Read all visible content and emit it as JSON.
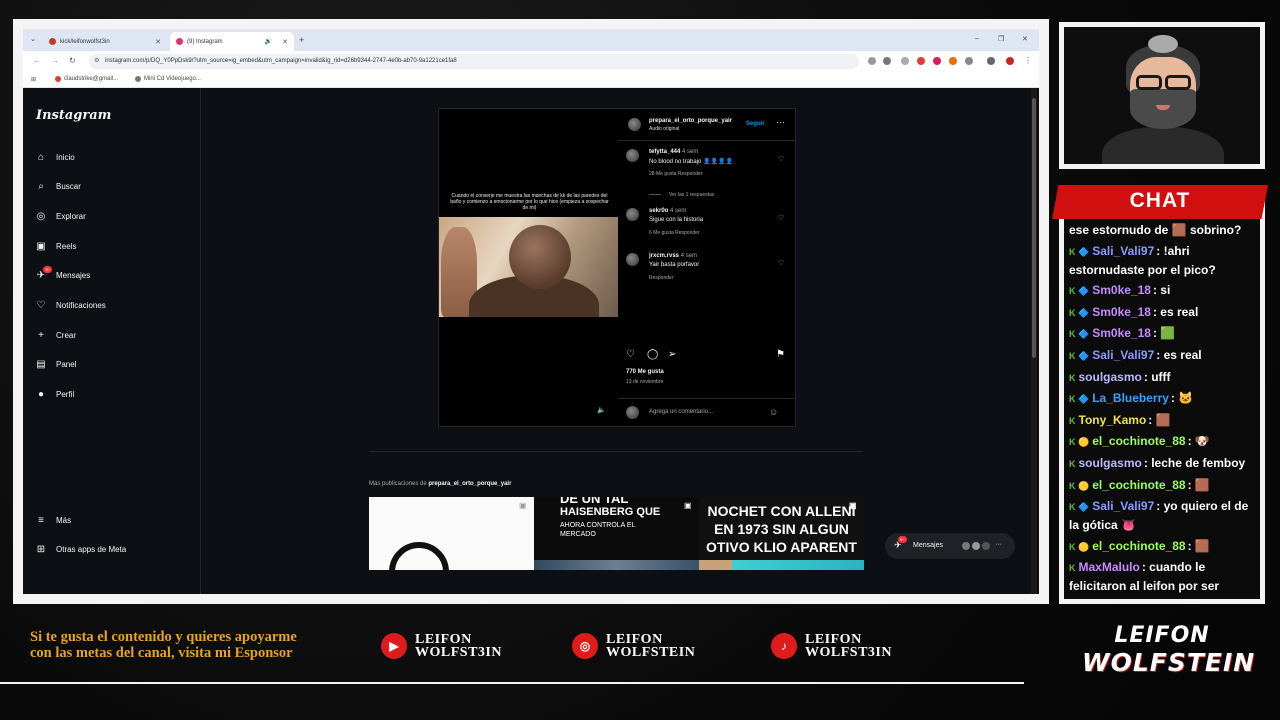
{
  "browser": {
    "tabs": [
      {
        "label": "kick/leifonwolfst3in",
        "active": false,
        "favicon_color": "#c0392b"
      },
      {
        "label": "(9) Instagram",
        "active": true,
        "favicon_color": "#e1306c"
      }
    ],
    "url": "instagram.com/p/DQ_Y0PpDsk9/?utm_source=ig_embed&utm_campaign=invalid&ig_rid=d26b9344-2747-4e0b-ab70-9a1221ce1fa8",
    "bookmarks": [
      "claudstrike@gmail...",
      "Mini Cd Videojuego..."
    ]
  },
  "instagram": {
    "logo": "Instagram",
    "nav": [
      {
        "label": "Inicio",
        "icon": "home-icon",
        "glyph": "⌂"
      },
      {
        "label": "Buscar",
        "icon": "search-icon",
        "glyph": "⌕"
      },
      {
        "label": "Explorar",
        "icon": "compass-icon",
        "glyph": "◎"
      },
      {
        "label": "Reels",
        "icon": "reels-icon",
        "glyph": "▣"
      },
      {
        "label": "Mensajes",
        "icon": "messenger-icon",
        "glyph": "✈"
      },
      {
        "label": "Notificaciones",
        "icon": "heart-icon",
        "glyph": "♡"
      },
      {
        "label": "Crear",
        "icon": "plus-icon",
        "glyph": "+"
      },
      {
        "label": "Panel",
        "icon": "chart-icon",
        "glyph": "▤"
      },
      {
        "label": "Perfil",
        "icon": "profile-avatar",
        "glyph": "●"
      }
    ],
    "messages_badge": "9+",
    "nav_bottom": [
      {
        "label": "Más",
        "icon": "menu-icon",
        "glyph": "≡"
      },
      {
        "label": "Otras apps de Meta",
        "icon": "meta-apps-icon",
        "glyph": "⊞"
      }
    ],
    "post": {
      "caption": "Cuando el conserje me muestra las manchas de kk de las paredes del baño y comienzo a emocionarme por lo que hice (empieza a sospechar de mi)",
      "author": "prepara_el_orto_porque_yair",
      "audio": "Audio original",
      "follow": "Seguir",
      "comments": [
        {
          "user": "tefytta_444",
          "age": "4 sem",
          "text": "No blood no trabajo 👤👤👤👤",
          "meta": "28 Me gusta   Responder"
        },
        {
          "user": "sekr0o",
          "age": "4 sem",
          "text": "Sigue con la historia",
          "meta": "6 Me gusta   Responder"
        },
        {
          "user": "jrxcm.rvss",
          "age": "4 sem",
          "text": "Yair basta porfavor",
          "meta": "Responder"
        }
      ],
      "replies": "Ver las 1 respuestas",
      "likes": "770 Me gusta",
      "date": "13 de noviembre",
      "add_comment": "Agrega un comentario..."
    },
    "more_pubs_prefix": "Más publicaciones de",
    "more_pubs_user": "prepara_el_orto_porque_yair",
    "thumbs": {
      "t2": [
        "DE UN TAL",
        "HAISENBERG QUE",
        "AHORA CONTROLA EL MERCADO"
      ],
      "t3": [
        "NOCHET CON ALLENI",
        "EN 1973 SIN ALGUN",
        "OTIVO KLIO APARENT"
      ]
    },
    "msgbar": {
      "label": "Mensajes",
      "badge": "9+"
    }
  },
  "chat": {
    "title": "CHAT",
    "lines": [
      {
        "badges": "",
        "user": "",
        "user_color": "#ffffff",
        "text": "ese estornudo de 🟫 sobrino?"
      },
      {
        "badges": "K 🔷",
        "user": "Sali_Vali97",
        "user_color": "#8a9bff",
        "text": ": !ahri estornudaste por el pico?"
      },
      {
        "badges": "K 🔷",
        "user": "Sm0ke_18",
        "user_color": "#c58bff",
        "text": ": si"
      },
      {
        "badges": "K 🔷",
        "user": "Sm0ke_18",
        "user_color": "#c58bff",
        "text": ": es real"
      },
      {
        "badges": "K 🔷",
        "user": "Sm0ke_18",
        "user_color": "#c58bff",
        "text": ": 🟩"
      },
      {
        "badges": "K 🔷",
        "user": "Sali_Vali97",
        "user_color": "#8a9bff",
        "text": ": es real"
      },
      {
        "badges": "K",
        "user": "soulgasmo",
        "user_color": "#b9b9ff",
        "text": ": ufff"
      },
      {
        "badges": "K 🔷",
        "user": "La_Blueberry",
        "user_color": "#3aa0ff",
        "text": ": 🐱"
      },
      {
        "badges": "K",
        "user": "Tony_Kamo",
        "user_color": "#f0e14a",
        "text": ": 🟫"
      },
      {
        "badges": "K 🟡",
        "user": "el_cochinote_88",
        "user_color": "#9aff5a",
        "text": ": 🐶"
      },
      {
        "badges": "K",
        "user": "soulgasmo",
        "user_color": "#b9b9ff",
        "text": ": leche de femboy"
      },
      {
        "badges": "K 🟡",
        "user": "el_cochinote_88",
        "user_color": "#9aff5a",
        "text": ": 🟫"
      },
      {
        "badges": "K 🔷",
        "user": "Sali_Vali97",
        "user_color": "#8a9bff",
        "text": ": yo quiero el de la gótica 👅"
      },
      {
        "badges": "K 🟡",
        "user": "el_cochinote_88",
        "user_color": "#9aff5a",
        "text": ": 🟫"
      },
      {
        "badges": "K",
        "user": "MaxMalulo",
        "user_color": "#c58bff",
        "text": ": cuando le felicitaron al leifon por ser femboy"
      }
    ]
  },
  "footer": {
    "support_text": "Si te gusta el contenido y quieres apoyarme con las metas del canal, visita mi Esponsor",
    "socials": [
      {
        "platform": "youtube",
        "icon": "youtube-icon",
        "glyph": "▶",
        "line1": "LEIFON",
        "line2": "WOLFST3IN"
      },
      {
        "platform": "instagram",
        "icon": "instagram-icon",
        "glyph": "◎",
        "line1": "LEIFON",
        "line2": "WOLFSTEIN"
      },
      {
        "platform": "tiktok",
        "icon": "tiktok-icon",
        "glyph": "♪",
        "line1": "LEIFON",
        "line2": "WOLFST3IN"
      }
    ],
    "brand_line1": "LEIFON",
    "brand_line2": "WOLFSTEIN"
  },
  "colors": {
    "accent_red": "#d10f0f",
    "support_gold": "#e8a21c",
    "ig_link_blue": "#0095f6"
  }
}
